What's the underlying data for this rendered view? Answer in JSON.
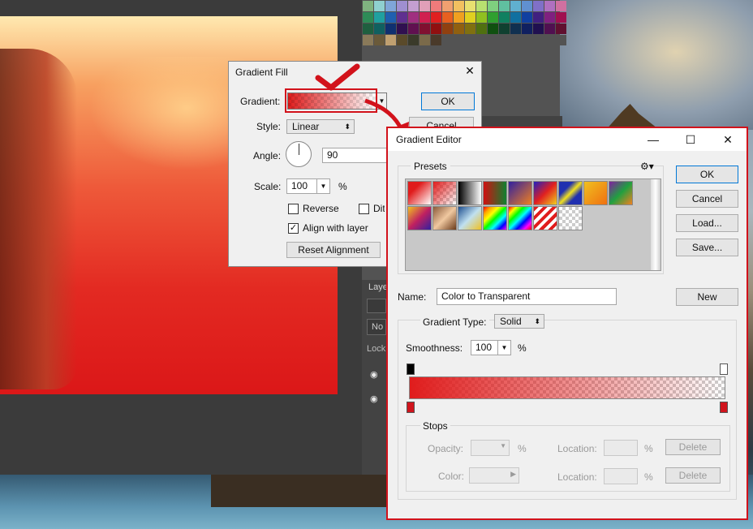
{
  "gradient_fill": {
    "title": "Gradient Fill",
    "gradient_label": "Gradient:",
    "style_label": "Style:",
    "style_value": "Linear",
    "angle_label": "Angle:",
    "angle_value": "90",
    "scale_label": "Scale:",
    "scale_value": "100",
    "scale_unit": "%",
    "reverse_label": "Reverse",
    "dither_label": "Dit",
    "align_label": "Align with layer",
    "reset_label": "Reset Alignment",
    "ok_label": "OK",
    "cancel_label": "Cancel"
  },
  "gradient_editor": {
    "title": "Gradient Editor",
    "presets_label": "Presets",
    "ok_label": "OK",
    "cancel_label": "Cancel",
    "load_label": "Load...",
    "save_label": "Save...",
    "name_label": "Name:",
    "name_value": "Color to Transparent",
    "new_label": "New",
    "gradient_type_label": "Gradient Type:",
    "gradient_type_value": "Solid",
    "smoothness_label": "Smoothness:",
    "smoothness_value": "100",
    "smoothness_unit": "%",
    "stops_label": "Stops",
    "opacity_label": "Opacity:",
    "percent": "%",
    "location_label": "Location:",
    "delete_label": "Delete",
    "color_label": "Color:"
  },
  "layers": {
    "label": "Laye",
    "blend_short": "No",
    "lock_short": "Lock"
  },
  "colors": {
    "accent_red": "#d2121b",
    "gradient_red": "#e01c1c"
  },
  "icons": {
    "close": "close-icon",
    "gear": "gear-icon",
    "eye": "eye-icon",
    "dropdown": "chevron-down-icon"
  }
}
